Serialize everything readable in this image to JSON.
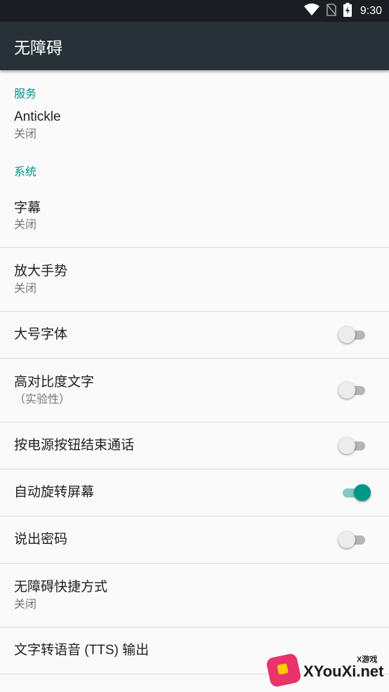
{
  "status_bar": {
    "time": "9:30",
    "icons": [
      "wifi-icon",
      "no-sim-icon",
      "battery-charging-icon"
    ]
  },
  "app_bar": {
    "title": "无障碍"
  },
  "sections": {
    "services": {
      "header": "服务",
      "items": [
        {
          "title": "Antickle",
          "summary": "关闭"
        }
      ]
    },
    "system": {
      "header": "系统",
      "items": [
        {
          "title": "字幕",
          "summary": "关闭"
        },
        {
          "title": "放大手势",
          "summary": "关闭"
        },
        {
          "title": "大号字体",
          "switch": "off"
        },
        {
          "title": "高对比度文字",
          "summary": "（实验性）",
          "switch": "off"
        },
        {
          "title": "按电源按钮结束通话",
          "switch": "off"
        },
        {
          "title": "自动旋转屏幕",
          "switch": "on"
        },
        {
          "title": "说出密码",
          "switch": "off"
        },
        {
          "title": "无障碍快捷方式",
          "summary": "关闭"
        },
        {
          "title": "文字转语音 (TTS) 输出"
        }
      ]
    }
  },
  "watermark": {
    "brand": "XYouXi.net",
    "brand_small": "X游戏"
  },
  "colors": {
    "accent": "#009688",
    "app_bar": "#263238",
    "status_bar": "#1a1e22",
    "background": "#fafafa"
  }
}
